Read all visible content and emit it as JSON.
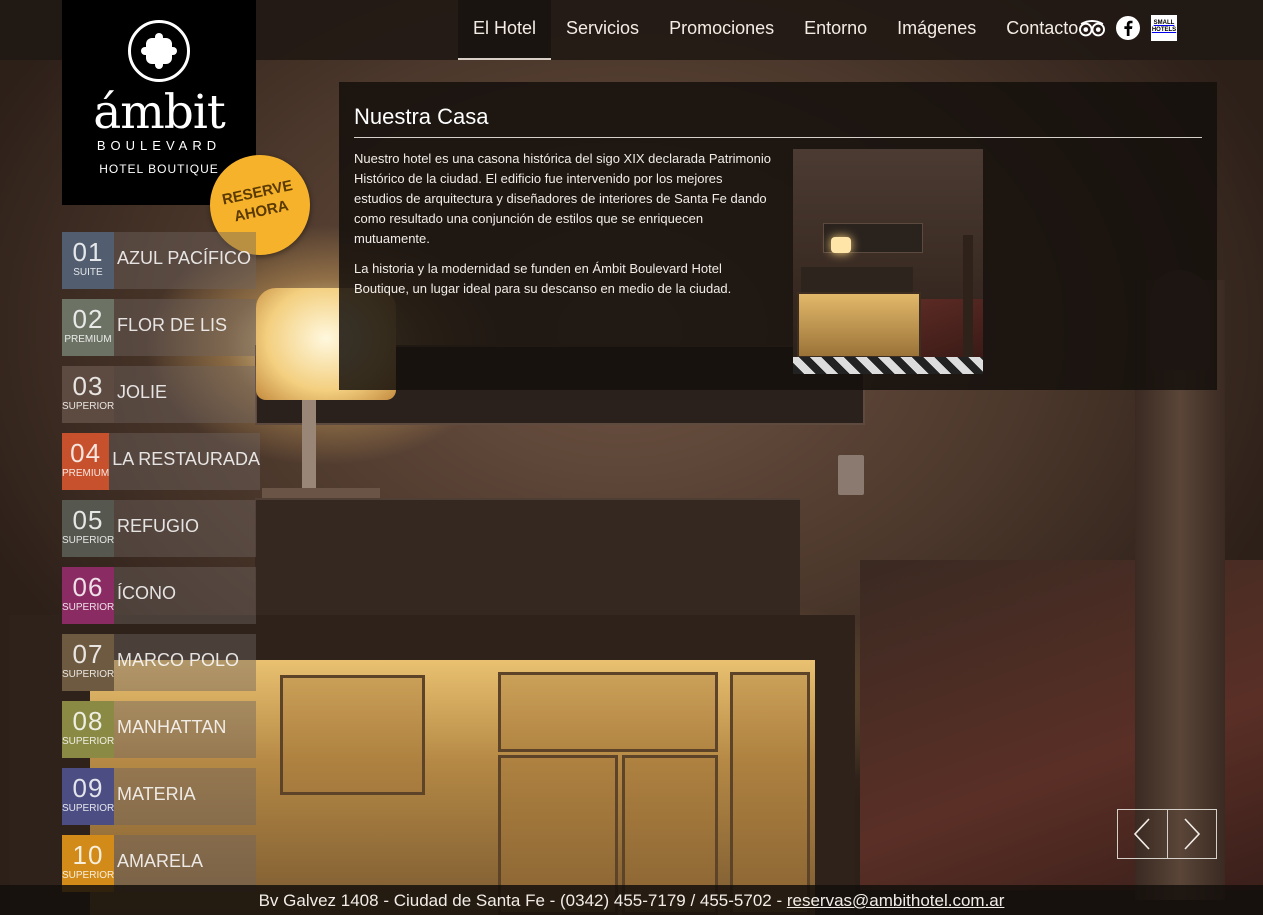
{
  "nav": {
    "items": [
      {
        "label": "El Hotel"
      },
      {
        "label": "Servicios"
      },
      {
        "label": "Promociones"
      },
      {
        "label": "Entorno"
      },
      {
        "label": "Imágenes"
      },
      {
        "label": "Contacto"
      }
    ],
    "active_index": 0
  },
  "social": {
    "icons": [
      "tripadvisor-icon",
      "facebook-icon",
      "small-hotels-icon"
    ],
    "small_hotels_text": "SMALL HOTELS"
  },
  "logo": {
    "name": "ámbit",
    "sub": "BOULEVARD",
    "tagline": "HOTEL BOUTIQUE"
  },
  "reserve": {
    "line1": "RESERVE",
    "line2": "AHORA"
  },
  "rooms": [
    {
      "num": "01",
      "tier": "SUITE",
      "name": "AZUL PACÍFICO",
      "color": "#525e70"
    },
    {
      "num": "02",
      "tier": "PREMIUM",
      "name": "FLOR DE LIS",
      "color": "#6c7365"
    },
    {
      "num": "03",
      "tier": "SUPERIOR",
      "name": "JOLIE",
      "color": "#5d4a40"
    },
    {
      "num": "04",
      "tier": "PREMIUM",
      "name": "LA RESTAURADA",
      "color": "#c7512c"
    },
    {
      "num": "05",
      "tier": "SUPERIOR",
      "name": "REFUGIO",
      "color": "#56574f"
    },
    {
      "num": "06",
      "tier": "SUPERIOR",
      "name": "ÍCONO",
      "color": "#8a2c63"
    },
    {
      "num": "07",
      "tier": "SUPERIOR",
      "name": "MARCO POLO",
      "color": "#6e5a40"
    },
    {
      "num": "08",
      "tier": "SUPERIOR",
      "name": "MANHATTAN",
      "color": "#8a8a45"
    },
    {
      "num": "09",
      "tier": "SUPERIOR",
      "name": "MATERIA",
      "color": "#4c4d82"
    },
    {
      "num": "10",
      "tier": "SUPERIOR",
      "name": "AMARELA",
      "color": "#d28b18"
    }
  ],
  "content": {
    "title": "Nuestra Casa",
    "paragraph1": "Nuestro hotel es una casona histórica del sigo XIX declarada Patrimonio Histórico de la ciudad. El edificio fue intervenido por los mejores estudios de arquitectura y diseñadores de interiores de Santa Fe dando como resultado una conjunción de estilos que se enriquecen mutuamente.",
    "paragraph2": "La historia y la modernidad se funden en Ámbit Boulevard Hotel Boutique, un lugar ideal para su descanso en medio de la ciudad."
  },
  "slider": {
    "prev": "chevron-left-icon",
    "next": "chevron-right-icon"
  },
  "footer": {
    "address": "Bv Galvez 1408 - Ciudad de Santa Fe - (0342) 455-7179 / 455-5702 - ",
    "email": "reservas@ambithotel.com.ar"
  }
}
